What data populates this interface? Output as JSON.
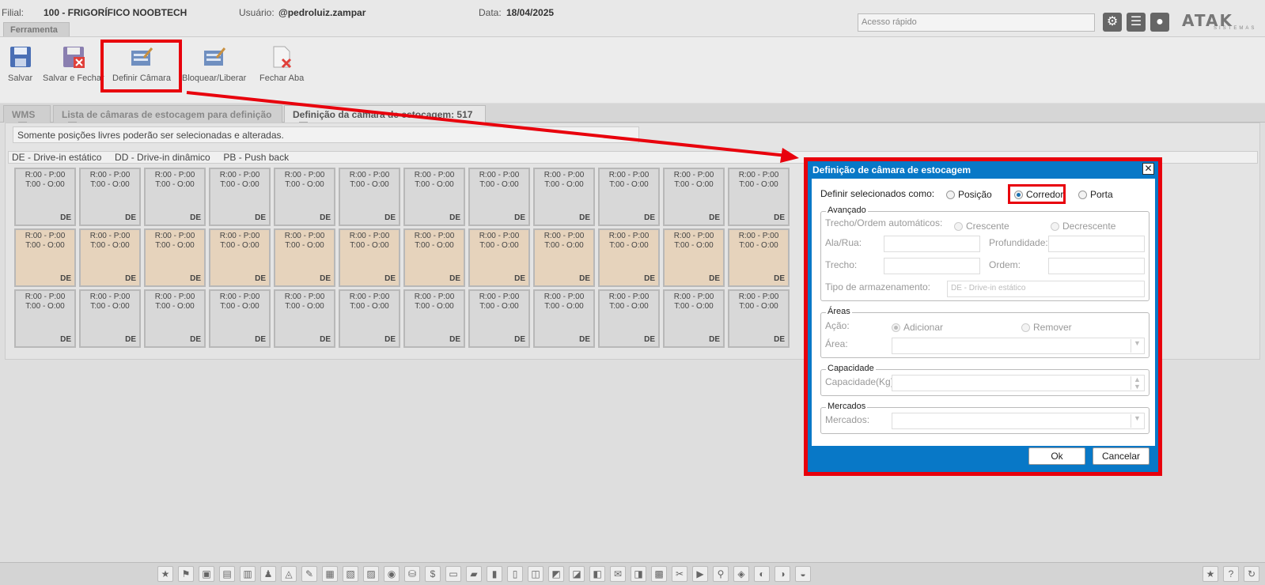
{
  "header": {
    "filial_label": "Filial:",
    "filial_value": "100 - FRIGORÍFICO NOOBTECH",
    "user_label": "Usuário:",
    "user_value": "@pedroluiz.zampar",
    "date_label": "Data:",
    "date_value": "18/04/2025",
    "quick_access_placeholder": "Acesso rápido",
    "logo": "ATAK",
    "logo_sub": "SISTEMAS",
    "tool_tab": "Ferramenta"
  },
  "toolbar": {
    "save": "Salvar",
    "save_close": "Salvar e Fechar",
    "define_chamber": "Definir Câmara",
    "block_release": "Bloquear/Liberar",
    "close_tab": "Fechar Aba"
  },
  "tabs": [
    {
      "label": "WMS"
    },
    {
      "label": "Lista de câmaras de estocagem para definição"
    },
    {
      "label": "Definição da câmara de estocagem: 517"
    }
  ],
  "content": {
    "notice": "Somente posições livres poderão ser selecionadas e alteradas.",
    "legend": "DE - Drive-in estático     DD - Drive-in dinâmico     PB - Push back",
    "cell_line1": "R:00 - P:00",
    "cell_line2": "T:00 - O:00",
    "cell_type": "DE",
    "rows": [
      {
        "color": "gray",
        "count": 12
      },
      {
        "color": "orange",
        "count": 12
      },
      {
        "color": "gray",
        "count": 12
      }
    ]
  },
  "dialog": {
    "title": "Definição de câmara de estocagem",
    "define_as_label": "Definir selecionados como:",
    "options": [
      "Posição",
      "Corredor",
      "Porta"
    ],
    "selected_option": "Corredor",
    "advanced": {
      "legend": "Avançado",
      "auto_label": "Trecho/Ordem automáticos:",
      "crescente": "Crescente",
      "decrescente": "Decrescente",
      "aisle_label": "Ala/Rua:",
      "depth_label": "Profundidade:",
      "stretch_label": "Trecho:",
      "order_label": "Ordem:",
      "storage_type_label": "Tipo de armazenamento:",
      "storage_type_value": "DE - Drive-in estático"
    },
    "areas": {
      "legend": "Áreas",
      "action_label": "Ação:",
      "add": "Adicionar",
      "remove": "Remover",
      "area_label": "Área:"
    },
    "capacity": {
      "legend": "Capacidade",
      "label": "Capacidade(Kg):"
    },
    "markets": {
      "legend": "Mercados",
      "label": "Mercados:"
    },
    "ok": "Ok",
    "cancel": "Cancelar"
  },
  "colors": {
    "highlight": "#e8000c",
    "dialog_blue": "#0878c7",
    "cell_gray": "#d8d8d8",
    "cell_orange": "#e6d3bc"
  }
}
